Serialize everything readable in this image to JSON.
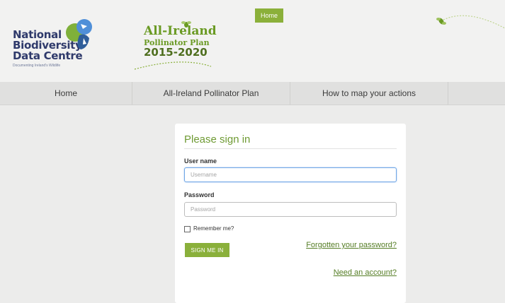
{
  "header": {
    "nbdc_logo": {
      "lines": [
        "National",
        "Biodiversity",
        "Data Centre"
      ],
      "tagline": "Documenting Ireland's Wildlife"
    },
    "plan_logo": {
      "title": "All-Ireland",
      "subtitle": "Pollinator Plan",
      "years": "2015-2020"
    },
    "home_tab": "Home"
  },
  "nav": {
    "items": [
      {
        "label": "Home"
      },
      {
        "label": "All-Ireland Pollinator Plan"
      },
      {
        "label": "How to map your actions"
      }
    ]
  },
  "login": {
    "heading": "Please sign in",
    "username_label": "User name",
    "username_placeholder": "Username",
    "username_value": "",
    "password_label": "Password",
    "password_placeholder": "Password",
    "password_value": "",
    "remember_label": "Remember me?",
    "remember_checked": false,
    "submit_label": "SIGN ME IN",
    "forgot_link": "Forgotten your password?",
    "account_link": "Need an account?"
  },
  "colors": {
    "accent_green": "#8ab03b",
    "heading_green": "#6f9b34",
    "nbdc_navy": "#2f3a6b",
    "focus_blue": "#6fa6e6"
  },
  "icons": {
    "nbdc": "nbdc-leaf-bird-logo-icon",
    "bee": "bee-icon"
  }
}
